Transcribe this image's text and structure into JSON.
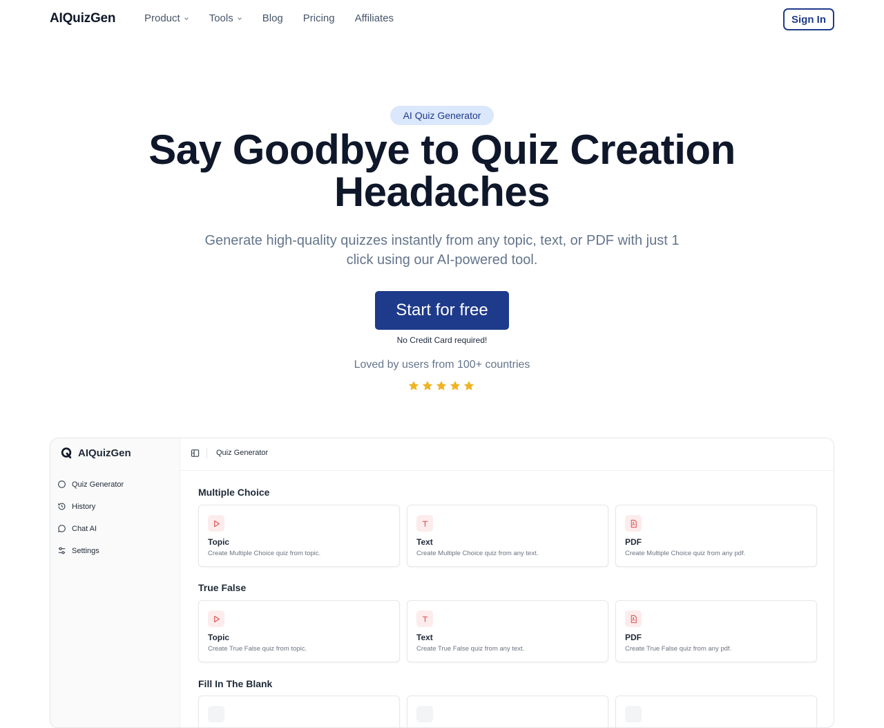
{
  "nav": {
    "logo": "AIQuizGen",
    "links": [
      {
        "label": "Product",
        "dropdown": true
      },
      {
        "label": "Tools",
        "dropdown": true
      },
      {
        "label": "Blog",
        "dropdown": false
      },
      {
        "label": "Pricing",
        "dropdown": false
      },
      {
        "label": "Affiliates",
        "dropdown": false
      }
    ],
    "signin_label": "Sign In"
  },
  "hero": {
    "badge": "AI Quiz Generator",
    "title": "Say Goodbye to Quiz Creation Headaches",
    "subtitle": "Generate high-quality quizzes instantly from any topic, text, or PDF with just 1 click using our AI-powered tool.",
    "cta_label": "Start for free",
    "no_card": "No Credit Card required!",
    "loved": "Loved by users from 100+ countries",
    "rating_stars": 5
  },
  "app": {
    "brand": "AIQuizGen",
    "sidebar": [
      {
        "label": "Quiz Generator",
        "icon": "circle-icon"
      },
      {
        "label": "History",
        "icon": "history-icon"
      },
      {
        "label": "Chat AI",
        "icon": "chat-icon"
      },
      {
        "label": "Settings",
        "icon": "sliders-icon"
      }
    ],
    "breadcrumb": "Quiz Generator",
    "sections": [
      {
        "title": "Multiple Choice",
        "cards": [
          {
            "title": "Topic",
            "desc": "Create Multiple Choice quiz from topic.",
            "icon": "play-icon"
          },
          {
            "title": "Text",
            "desc": "Create Multiple Choice quiz from any text.",
            "icon": "text-icon"
          },
          {
            "title": "PDF",
            "desc": "Create Multiple Choice quiz from any pdf.",
            "icon": "pdf-icon"
          }
        ]
      },
      {
        "title": "True False",
        "cards": [
          {
            "title": "Topic",
            "desc": "Create True False quiz from topic.",
            "icon": "play-icon"
          },
          {
            "title": "Text",
            "desc": "Create True False quiz from any text.",
            "icon": "text-icon"
          },
          {
            "title": "PDF",
            "desc": "Create True False quiz from any pdf.",
            "icon": "pdf-icon"
          }
        ]
      },
      {
        "title": "Fill In The Blank",
        "cards": []
      }
    ]
  },
  "colors": {
    "brand": "#1e3a8a",
    "badge_bg": "#dbe7fb",
    "star": "#f0b322",
    "icon_accent": "#dc4b4b"
  }
}
